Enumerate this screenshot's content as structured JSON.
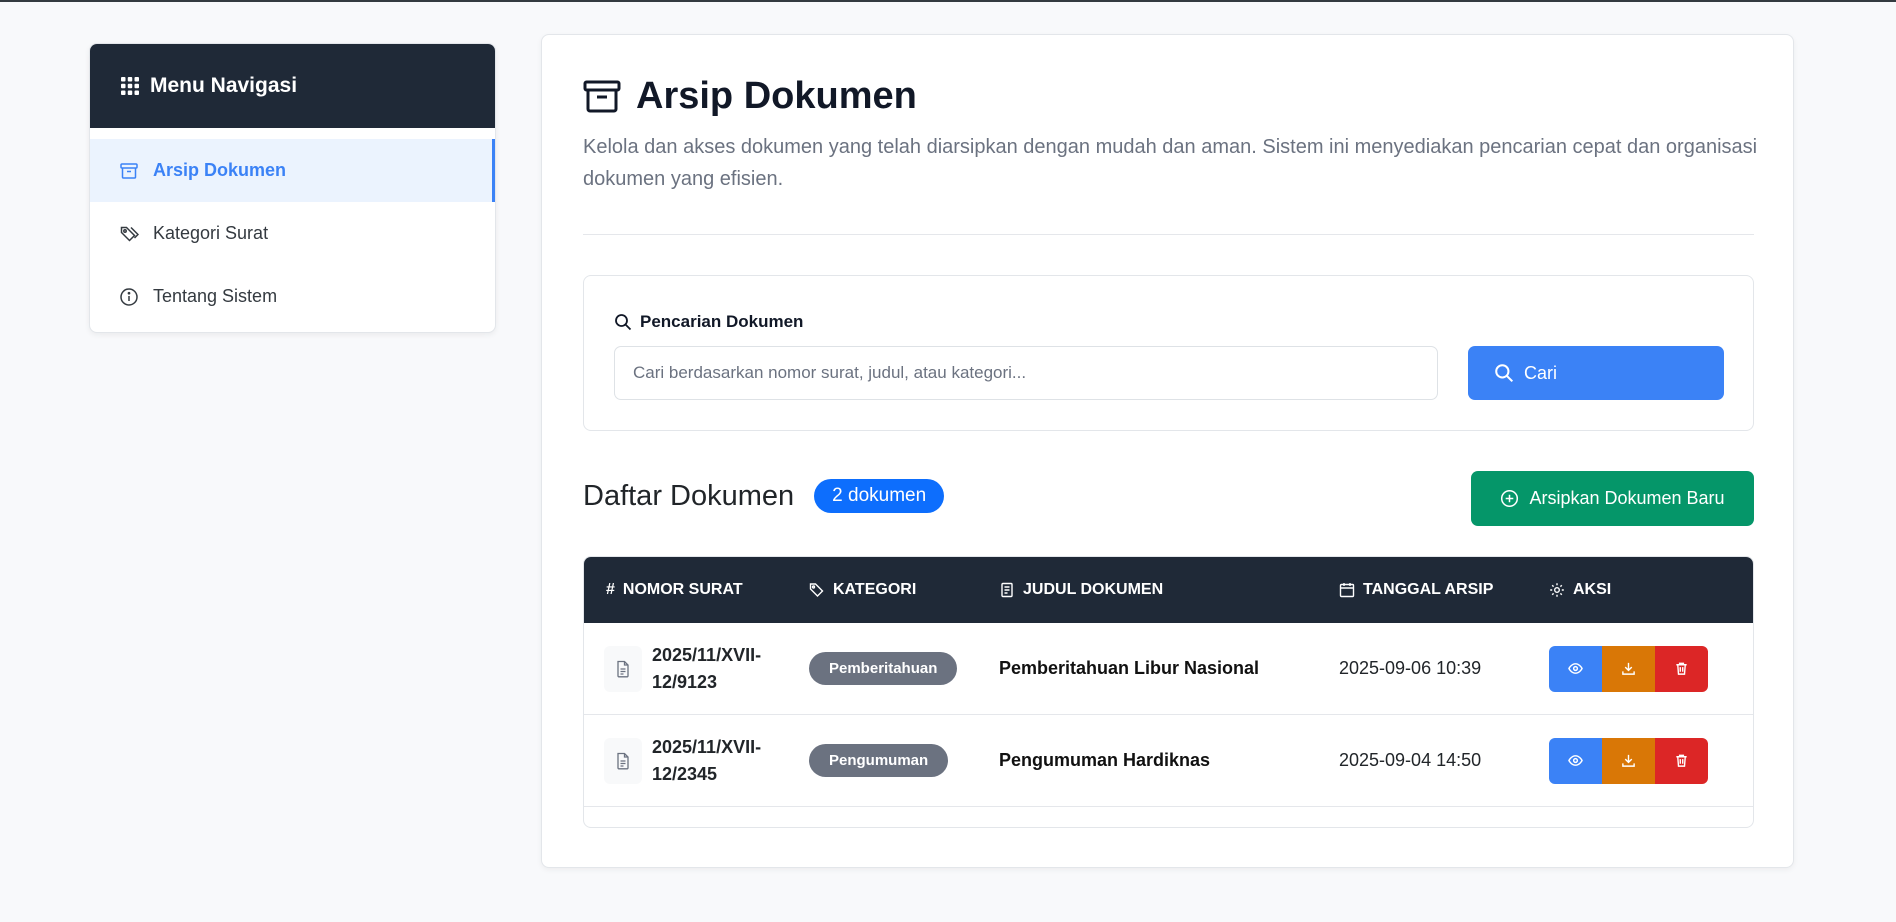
{
  "sidebar": {
    "header": "Menu Navigasi",
    "header_icon": "grid-icon",
    "items": [
      {
        "label": "Arsip Dokumen",
        "icon": "archive-icon",
        "active": true
      },
      {
        "label": "Kategori Surat",
        "icon": "tags-icon",
        "active": false
      },
      {
        "label": "Tentang Sistem",
        "icon": "info-icon",
        "active": false
      }
    ]
  },
  "main": {
    "title": "Arsip Dokumen",
    "title_icon": "archive-icon",
    "description": "Kelola dan akses dokumen yang telah diarsipkan dengan mudah dan aman. Sistem ini menyediakan pencarian cepat dan organisasi dokumen yang efisien."
  },
  "search": {
    "label": "Pencarian Dokumen",
    "value": "",
    "placeholder": "Cari berdasarkan nomor surat, judul, atau kategori...",
    "button": "Cari"
  },
  "list": {
    "title": "Daftar Dokumen",
    "count": "2 dokumen",
    "add_button": "Arsipkan Dokumen Baru"
  },
  "table": {
    "headers": [
      "NOMOR SURAT",
      "KATEGORI",
      "JUDUL DOKUMEN",
      "TANGGAL ARSIP",
      "AKSI"
    ],
    "rows": [
      {
        "nomor": "2025/11/XVII-12/9123",
        "kategori": "Pemberitahuan",
        "judul": "Pemberitahuan Libur Nasional",
        "tanggal": "2025-09-06 10:39"
      },
      {
        "nomor": "2025/11/XVII-12/2345",
        "kategori": "Pengumuman",
        "judul": "Pengumuman Hardiknas",
        "tanggal": "2025-09-04 14:50"
      }
    ]
  },
  "colors": {
    "primary": "#3b82f6",
    "success": "#059669",
    "warning": "#d97706",
    "danger": "#dc2626",
    "dark": "#1f2937"
  }
}
